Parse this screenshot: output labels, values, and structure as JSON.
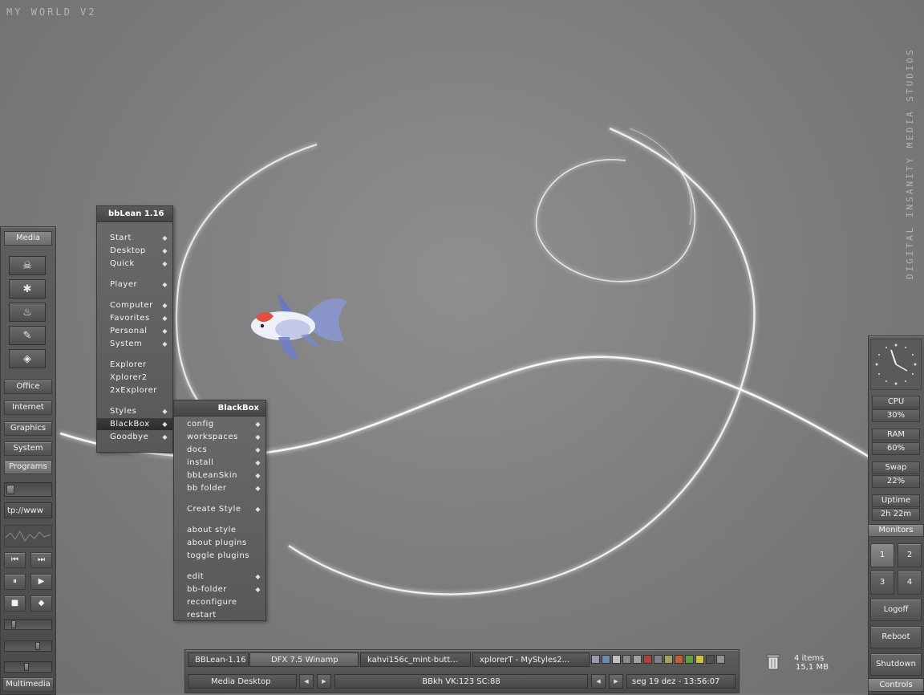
{
  "desktop": {
    "title": "MY WORLD V2",
    "vertical_text": "DIGITAL INSANITY MEDIA STUDIOS",
    "recycle_bin": {
      "items": "4 items",
      "size": "15,1 MB"
    }
  },
  "left_bar": {
    "media_label": "Media",
    "media_icons": [
      "alien-icon",
      "spider-icon",
      "fire-icon",
      "clapper-icon",
      "ticket-icon"
    ],
    "buttons": [
      "Office",
      "Internet",
      "Graphics",
      "System",
      "Programs"
    ],
    "url_field": "tp://www",
    "multimedia_label": "Multimedia",
    "player": {
      "prev": "⏮",
      "next": "⏭",
      "pause": "⏸",
      "play": "▶",
      "stop": "■",
      "eject": "◆"
    }
  },
  "main_menu": {
    "title": "bbLean 1.16",
    "groups": [
      [
        {
          "label": "Start",
          "sub": true
        },
        {
          "label": "Desktop",
          "sub": true
        },
        {
          "label": "Quick",
          "sub": true
        }
      ],
      [
        {
          "label": "Player",
          "sub": true
        }
      ],
      [
        {
          "label": "Computer",
          "sub": true
        },
        {
          "label": "Favorites",
          "sub": true
        },
        {
          "label": "Personal",
          "sub": true
        },
        {
          "label": "System",
          "sub": true
        }
      ],
      [
        {
          "label": "Explorer",
          "sub": false
        },
        {
          "label": "Xplorer2",
          "sub": false
        },
        {
          "label": "2xExplorer",
          "sub": false
        }
      ],
      [
        {
          "label": "Styles",
          "sub": true
        },
        {
          "label": "BlackBox",
          "sub": true
        },
        {
          "label": "Goodbye",
          "sub": true
        }
      ]
    ],
    "highlighted": "BlackBox"
  },
  "sub_menu": {
    "title": "BlackBox",
    "groups": [
      [
        {
          "label": "config",
          "sub": true
        },
        {
          "label": "workspaces",
          "sub": true
        },
        {
          "label": "docs",
          "sub": true
        },
        {
          "label": "install",
          "sub": true
        },
        {
          "label": "bbLeanSkin",
          "sub": true
        },
        {
          "label": "bb folder",
          "sub": true
        }
      ],
      [
        {
          "label": "Create Style",
          "sub": true
        }
      ],
      [
        {
          "label": "about style",
          "sub": false
        },
        {
          "label": "about plugins",
          "sub": false
        },
        {
          "label": "toggle plugins",
          "sub": false
        }
      ],
      [
        {
          "label": "edit",
          "sub": true
        },
        {
          "label": "bb-folder",
          "sub": true
        },
        {
          "label": "reconfigure",
          "sub": false
        },
        {
          "label": "restart",
          "sub": false
        }
      ]
    ]
  },
  "right_bar": {
    "monitors": [
      {
        "label": "CPU",
        "value": "30%"
      },
      {
        "label": "RAM",
        "value": "60%"
      },
      {
        "label": "Swap",
        "value": "22%"
      },
      {
        "label": "Uptime",
        "value": "2h 22m"
      }
    ],
    "monitors_label": "Monitors",
    "workspaces": [
      "1",
      "2",
      "3",
      "4"
    ],
    "active_workspace": "1",
    "logoff": "Logoff",
    "reboot": "Reboot",
    "shutdown": "Shutdown",
    "controls_label": "Controls"
  },
  "taskbar": {
    "tasks": [
      "BBLean-1.16",
      "DFX 7.5 Winamp",
      "kahvi156c_mint-butt...",
      "xplorerT - MyStyles2..."
    ],
    "selected_task": "DFX 7.5 Winamp",
    "workspace_name": "Media Desktop",
    "status_text": "BBkh VK:123 SC:88",
    "datetime": "seg 19 dez - 13:56:07",
    "tray_colors": [
      "#9a9ab0",
      "#6a8ab0",
      "#c0c0c0",
      "#888888",
      "#a0a0a0",
      "#b04040",
      "#808080",
      "#a0a060",
      "#c06030",
      "#60a040",
      "#d0c040",
      "#505050",
      "#909090"
    ]
  }
}
